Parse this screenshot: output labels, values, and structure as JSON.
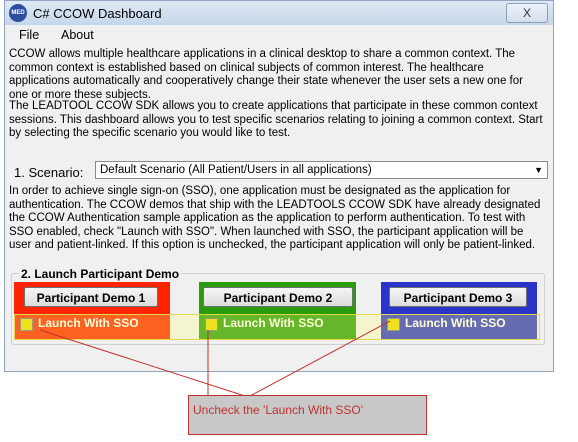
{
  "window": {
    "title": "C# CCOW Dashboard",
    "close_symbol": "X"
  },
  "menu": {
    "items": [
      "File",
      "About"
    ]
  },
  "description1": "CCOW allows multiple healthcare applications in a clinical desktop to share a common context.  The common context is established based on clinical subjects of common interest.  The healthcare applications automatically and cooperatively change their state whenever the user sets a new one for one or more these subjects.",
  "description2": "The LEADTOOL CCOW SDK allows you to create applications that participate in these common context sessions.  This dashboard allows you to test specific scenarios relating to joining a common context.  Start by selecting the specific scenario you would like to test.",
  "scenario": {
    "label": "1. Scenario:",
    "selected": "Default Scenario (All Patient/Users in all applications)"
  },
  "sso_info": "In order to achieve single sign-on (SSO), one application must be designated as the application for authentication.  The CCOW demos that ship with the LEADTOOLS CCOW SDK have already designated the CCOW Authentication sample application as the application to perform authentication.  To test with SSO enabled, check \"Launch with SSO\".  When launched with SSO, the participant application will be user and patient-linked.  If this option is unchecked, the participant application will only be patient-linked.",
  "launch": {
    "title": "2. Launch Participant Demo",
    "demos": [
      {
        "button": "Participant Demo 1",
        "sso_label": "Launch With SSO",
        "sso_checked": false,
        "color": "#ff2400"
      },
      {
        "button": "Participant Demo 2",
        "sso_label": "Launch With SSO",
        "sso_checked": false,
        "color": "#2a9c0c"
      },
      {
        "button": "Participant Demo 3",
        "sso_label": "Launch With SSO",
        "sso_checked": false,
        "color": "#2b34c8"
      }
    ]
  },
  "callout": {
    "text": "Uncheck the 'Launch With SSO'",
    "color": "#c0322e"
  }
}
